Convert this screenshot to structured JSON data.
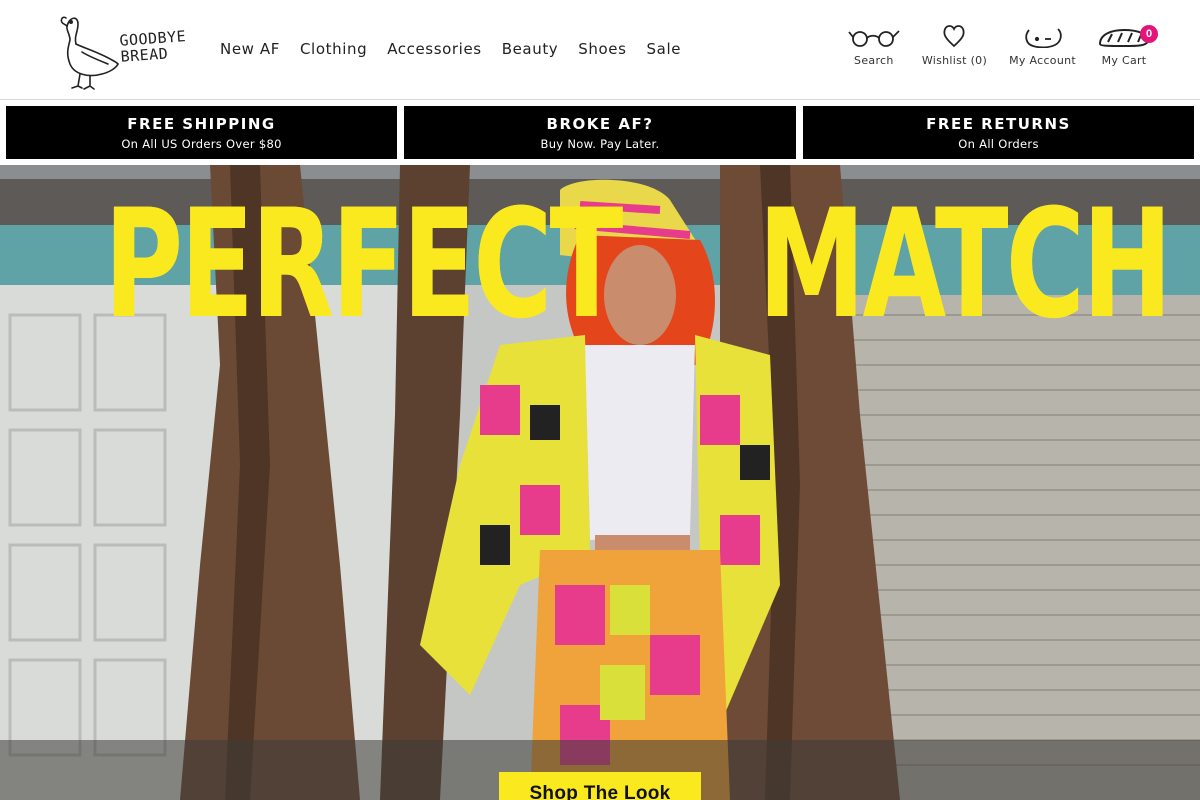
{
  "brand": {
    "name_line1": "GOODBYE",
    "name_line2": "BREAD"
  },
  "nav": {
    "items": [
      {
        "label": "New AF"
      },
      {
        "label": "Clothing"
      },
      {
        "label": "Accessories"
      },
      {
        "label": "Beauty"
      },
      {
        "label": "Shoes"
      },
      {
        "label": "Sale"
      }
    ]
  },
  "header_icons": {
    "search": {
      "label": "Search",
      "icon": "glasses-icon"
    },
    "wishlist": {
      "label": "Wishlist (0)",
      "icon": "heart-icon"
    },
    "account": {
      "label": "My Account",
      "icon": "face-icon"
    },
    "cart": {
      "label": "My Cart",
      "icon": "bread-icon",
      "count": "0"
    }
  },
  "promos": [
    {
      "title": "FREE SHIPPING",
      "subtitle": "On All US Orders Over $80"
    },
    {
      "title": "BROKE AF?",
      "subtitle": "Buy Now. Pay Later."
    },
    {
      "title": "FREE RETURNS",
      "subtitle": "On All Orders"
    }
  ],
  "hero": {
    "title_left": "PERFECT",
    "title_right": "MATCH",
    "cta_label": "Shop The Look"
  },
  "colors": {
    "accent_yellow": "#fbe91f",
    "badge_pink": "#e5147a",
    "promo_black": "#000000"
  }
}
